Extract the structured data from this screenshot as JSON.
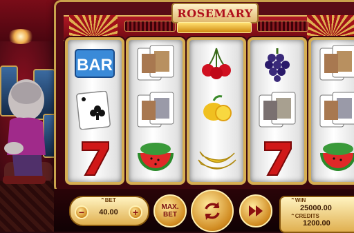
{
  "game": {
    "title": "ROSEMARY"
  },
  "reels": [
    {
      "symbols": [
        "bar",
        "ace-of-clubs-card",
        "seven"
      ]
    },
    {
      "symbols": [
        "face-card",
        "face-card",
        "watermelon"
      ]
    },
    {
      "symbols": [
        "cherries",
        "lemon",
        "banana"
      ]
    },
    {
      "symbols": [
        "grapes",
        "face-card",
        "seven"
      ]
    },
    {
      "symbols": [
        "face-card",
        "face-card",
        "watermelon"
      ]
    }
  ],
  "symbol_text": {
    "bar": "BAR"
  },
  "controls": {
    "bet_label": "BET",
    "bet_value": "40.00",
    "minus_label": "−",
    "plus_label": "+",
    "maxbet_line1": "MAX.",
    "maxbet_line2": "BET",
    "win_label": "WIN",
    "win_value": "25000.00",
    "credits_label": "CREDITS",
    "credits_value": "1200.00"
  },
  "colors": {
    "accent_gold": "#d6ae52",
    "machine_red": "#b01824",
    "seven_red": "#d01818"
  }
}
